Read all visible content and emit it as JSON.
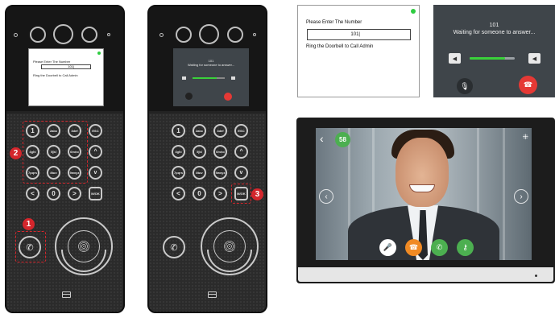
{
  "device_keypad": {
    "keys": [
      {
        "label": "1"
      },
      {
        "label": "2abc"
      },
      {
        "label": "3def"
      },
      {
        "label": "ESC"
      },
      {
        "label": "4ghi"
      },
      {
        "label": "5jkl"
      },
      {
        "label": "6mno"
      },
      {
        "label": "^"
      },
      {
        "label": "7pqrs"
      },
      {
        "label": "8tuv"
      },
      {
        "label": "9wxyz"
      },
      {
        "label": "v"
      },
      {
        "label": "<"
      },
      {
        "label": "0"
      },
      {
        "label": ">"
      },
      {
        "label": "M/OK"
      }
    ]
  },
  "device_left_screen": {
    "prompt": "Please Enter The Number",
    "value": "101|",
    "hint": "Ring the Doorbell to Call Admin"
  },
  "device_right_screen": {
    "number": "101",
    "status": "Waiting for someone to answer..."
  },
  "badges": {
    "one": "1",
    "two": "2",
    "three": "3"
  },
  "enlarged_entry": {
    "prompt": "Please Enter The Number",
    "value": "101|",
    "hint": "Ring the Doorbell to Call Admin",
    "status_color": "#2ecc40"
  },
  "enlarged_call": {
    "number": "101",
    "status": "Waiting for someone to answer...",
    "volume_fraction": 0.78,
    "hangup_color": "#e53935",
    "volume_color": "#3ad13a"
  },
  "monitor": {
    "back_icon": "back-arrow-icon",
    "count": "58",
    "count_color": "#4caf50",
    "buttons": [
      {
        "name": "mute-icon",
        "color": "#ffffff"
      },
      {
        "name": "hangup-icon",
        "color": "#f08a24"
      },
      {
        "name": "answer-icon",
        "color": "#4caf50"
      },
      {
        "name": "unlock-key-icon",
        "color": "#4caf50"
      }
    ]
  },
  "accent_color": "#d4262c"
}
